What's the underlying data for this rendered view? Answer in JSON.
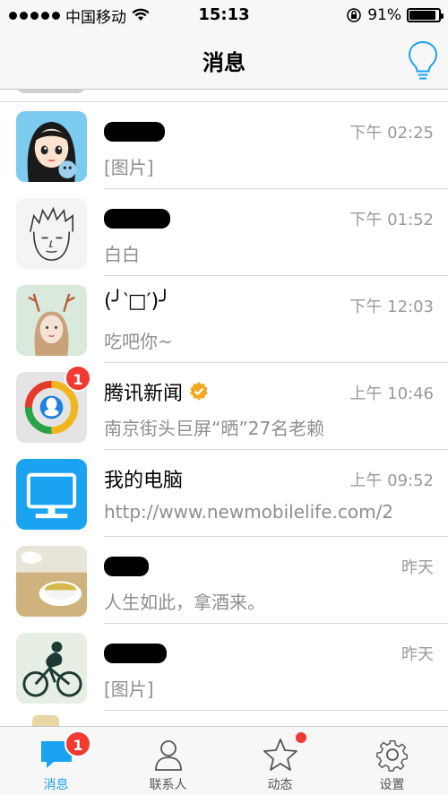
{
  "status_bar": {
    "carrier": "中国移动",
    "time": "15:13",
    "battery_percent": "91%",
    "battery_level": 0.91
  },
  "nav": {
    "title": "消息",
    "bulb_icon": "lightbulb-icon"
  },
  "conversations": [
    {
      "name": "",
      "time": "下午 02:25",
      "preview": "[图片]",
      "avatar": "cartoon-girl-avatar"
    },
    {
      "name": "",
      "time": "下午 01:52",
      "preview": "白白",
      "avatar": "sketch-boy-avatar"
    },
    {
      "name": "(╯‵□′)╯",
      "time": "下午 12:03",
      "preview": "吃吧你~",
      "avatar": "deer-girl-avatar"
    },
    {
      "name": "腾讯新闻",
      "time": "上午 10:46",
      "preview": "南京街头巨屏“晒”27名老赖",
      "avatar": "tencent-news-avatar",
      "badge": "1",
      "verified_icon": "verified-badge-icon"
    },
    {
      "name": "我的电脑",
      "time": "上午 09:52",
      "preview": "http://www.newmobilelife.com/2",
      "avatar": "computer-monitor-avatar"
    },
    {
      "name": "",
      "time": "昨天",
      "preview": "人生如此，拿酒来。",
      "avatar": "tea-cup-avatar"
    },
    {
      "name": "",
      "time": "昨天",
      "preview": "[图片]",
      "avatar": "cyclist-avatar"
    }
  ],
  "tabs": [
    {
      "label": "消息",
      "icon": "chat-bubble-icon",
      "badge": "1",
      "active": true
    },
    {
      "label": "联系人",
      "icon": "person-icon"
    },
    {
      "label": "动态",
      "icon": "star-icon",
      "dot": true
    },
    {
      "label": "设置",
      "icon": "gear-icon"
    }
  ],
  "colors": {
    "accent": "#1aa3f0",
    "badge": "#f03a32",
    "muted_text": "#8e8e8e"
  }
}
